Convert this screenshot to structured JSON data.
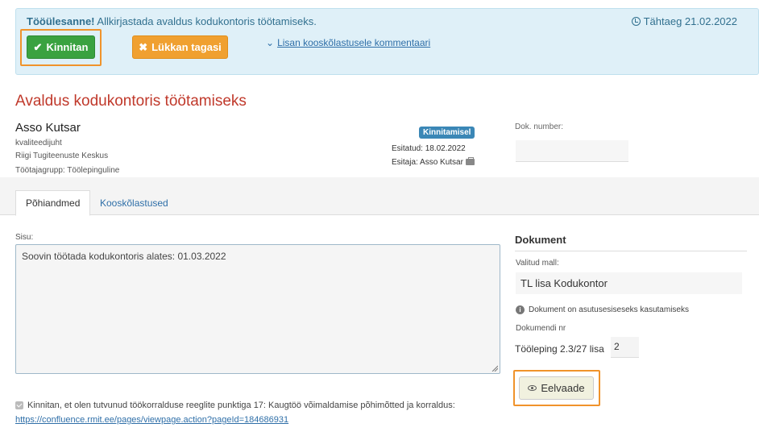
{
  "task": {
    "label": "Tööülesanne!",
    "text": "Allkirjastada avaldus kodukontoris töötamiseks.",
    "deadline": "Tähtaeg 21.02.2022"
  },
  "actions": {
    "approve_label": "Kinnitan",
    "reject_label": "Lükkan tagasi",
    "comment_link": "Lisan kooskõlastusele kommentaari"
  },
  "document": {
    "title": "Avaldus kodukontoris töötamiseks",
    "status": "Kinnitamisel",
    "submitted": "Esitatud: 18.02.2022",
    "submitter": "Esitaja: Asso Kutsar",
    "doc_number_label": "Dok. number:",
    "doc_number_value": ""
  },
  "person": {
    "name": "Asso Kutsar",
    "position": "kvaliteedijuht",
    "organization": "Riigi Tugiteenuste Keskus",
    "group": "Töötajagrupp: Töölepinguline"
  },
  "tabs": [
    {
      "label": "Põhiandmed"
    },
    {
      "label": "Kooskõlastused"
    }
  ],
  "content": {
    "label": "Sisu:",
    "text": "Soovin töötada kodukontoris alates: 01.03.2022"
  },
  "document_panel": {
    "title": "Dokument",
    "template_label": "Valitud mall:",
    "template_value": "TL lisa Kodukontor",
    "info_text": "Dokument on asutusesiseseks kasutamiseks",
    "docnr_label": "Dokumendi nr",
    "docnr_prefix": "Tööleping 2.3/27 lisa",
    "docnr_value": "2",
    "preview_label": "Eelvaade"
  },
  "confirmation": {
    "text": "Kinnitan, et olen tutvunud töökorralduse reeglite punktiga 17: Kaugtöö võimaldamise põhimõtted ja korraldus:",
    "link": "https://confluence.rmit.ee/pages/viewpage.action?pageId=184686931",
    "checked": true
  },
  "colors": {
    "approve": "#3aa240",
    "reject": "#f0a030",
    "highlight": "#f0932b",
    "title": "#c0392b",
    "link": "#2f6fa8",
    "banner_bg": "#dff0f8"
  }
}
